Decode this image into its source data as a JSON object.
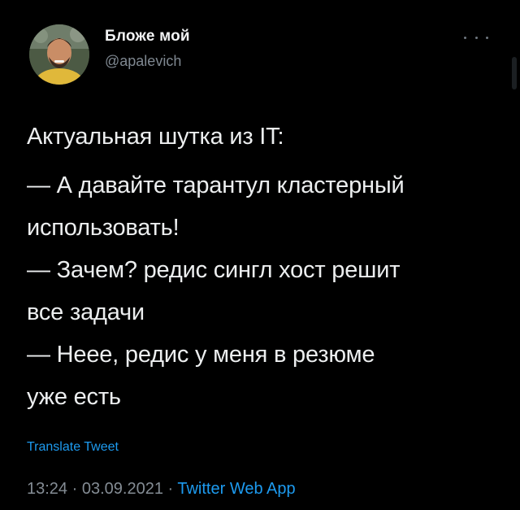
{
  "tweet": {
    "author": {
      "display_name": "Бложе мой",
      "handle": "@apalevich"
    },
    "text_lines": [
      "Актуальная шутка из IT:",
      "— А давайте тарантул кластерный",
      "использовать!",
      "— Зачем? редис сингл хост решит",
      "все задачи",
      "— Нееe, редис у меня в резюме",
      "уже есть"
    ],
    "translate_label": "Translate Tweet",
    "meta": {
      "time": "13:24",
      "separator_1": " · ",
      "date": "03.09.2021",
      "separator_2": " · ",
      "source": "Twitter Web App"
    }
  },
  "colors": {
    "background": "#000000",
    "text": "#e7e9ea",
    "secondary": "#848c94",
    "link": "#1d9bf0"
  },
  "icons": {
    "more": "more-horizontal-icon"
  }
}
